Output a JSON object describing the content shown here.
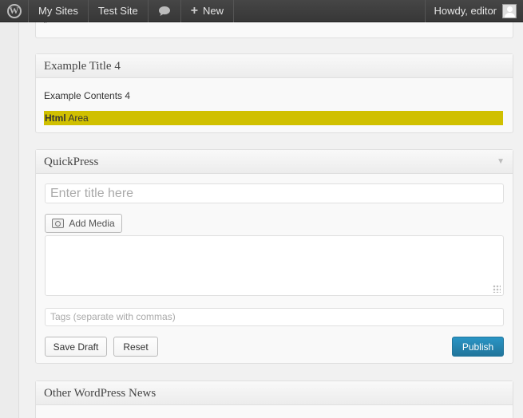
{
  "adminbar": {
    "logo_icon": "wordpress-logo-icon",
    "my_sites": "My Sites",
    "site_name": "Test Site",
    "comments_icon": "comment-bubble-icon",
    "new_label": "New",
    "greeting": "Howdy, editor"
  },
  "widget_ex4": {
    "title": "Example Title 4",
    "contents": "Example Contents 4",
    "html_bold": "Html",
    "html_rest": " Area",
    "highlight_color": "#d0c000"
  },
  "quickpress": {
    "title": "QuickPress",
    "title_placeholder": "Enter title here",
    "add_media": "Add Media",
    "tags_placeholder": "Tags (separate with commas)",
    "save_draft": "Save Draft",
    "reset": "Reset",
    "publish": "Publish",
    "publish_color": "#21759b"
  },
  "news": {
    "title": "Other WordPress News"
  }
}
